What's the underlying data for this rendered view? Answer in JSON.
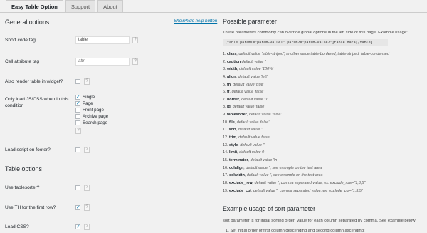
{
  "tabs": [
    {
      "label": "Easy Table Option"
    },
    {
      "label": "Support"
    },
    {
      "label": "About"
    }
  ],
  "left": {
    "general_heading": "General options",
    "help_link": "Show/hide help button",
    "short_code_label": "Short code tag",
    "short_code_value": "table",
    "cell_attr_label": "Cell attribute tag",
    "cell_attr_value": "attr",
    "widget_label": "Also render table in widget?",
    "load_js_label_1": "Only load JS/CSS when in this",
    "load_js_label_2": "condition",
    "conditions": [
      {
        "label": "Single",
        "checked": true
      },
      {
        "label": "Page",
        "checked": true
      },
      {
        "label": "Front page",
        "checked": false
      },
      {
        "label": "Archive page",
        "checked": false
      },
      {
        "label": "Search page",
        "checked": false
      }
    ],
    "footer_label": "Load script on footer?",
    "table_heading": "Table options",
    "tablesorter_label": "Use tablesorter?",
    "th_label": "Use TH for the first row?",
    "css_label": "Load CSS?",
    "help_glyph": "?"
  },
  "right": {
    "possible_heading": "Possible parameter",
    "intro": "These parameters commonly can override global options in the left side of this page. Example usage:",
    "code": "[table param1=\"param-value1\" param2=\"param-value2\"]table data[/table]",
    "params": [
      {
        "num": "1.",
        "name": "class",
        "desc": ", default value 'table-striped', another value table-bordered, table-striped, table-condensed"
      },
      {
        "num": "2.",
        "name": "caption",
        "desc": ",default value ''"
      },
      {
        "num": "3.",
        "name": "width",
        "desc": ", default value '100%'"
      },
      {
        "num": "4.",
        "name": "align",
        "desc": ", default value 'left'"
      },
      {
        "num": "5.",
        "name": "th",
        "desc": ", default value 'true'"
      },
      {
        "num": "6.",
        "name": "tf",
        "desc": ", default value 'false'"
      },
      {
        "num": "7.",
        "name": "border",
        "desc": ", default value '0'"
      },
      {
        "num": "8.",
        "name": "id",
        "desc": ", default value 'false'"
      },
      {
        "num": "9.",
        "name": "tablesorter",
        "desc": ", default value 'false'"
      },
      {
        "num": "10.",
        "name": "file",
        "desc": ", default value 'false'"
      },
      {
        "num": "11.",
        "name": "sort",
        "desc": ", default value ''"
      },
      {
        "num": "12.",
        "name": "trim",
        "desc": ", default value false"
      },
      {
        "num": "13.",
        "name": "style",
        "desc": ", default value ''"
      },
      {
        "num": "14.",
        "name": "limit",
        "desc": ", default value 0"
      },
      {
        "num": "15.",
        "name": "terminator",
        "desc": ", default value '\\n"
      },
      {
        "num": "16.",
        "name": "colalign",
        "desc": ", default value '', see example on the test area"
      },
      {
        "num": "17.",
        "name": "colwidth",
        "desc": ", default value '', see example on the test area"
      },
      {
        "num": "18.",
        "name": "exclude_row",
        "desc": ", default value '', comma separated value, ex: exclude_row=\"1,3,5\""
      },
      {
        "num": "19.",
        "name": "exclude_col",
        "desc": ", default value '', comma separated value, ex: exclude_col=\"1,3,5\""
      }
    ],
    "sort_heading": "Example usage of sort parameter",
    "sort_intro": "sort parameter is for initial sorting order. Value for each column separated by comma. See example below:",
    "sort_item": "1. Set initial order of first column descending and second column ascending:"
  },
  "colors": {
    "accent": "#0073aa",
    "checkmark": "#1e8cbe"
  }
}
